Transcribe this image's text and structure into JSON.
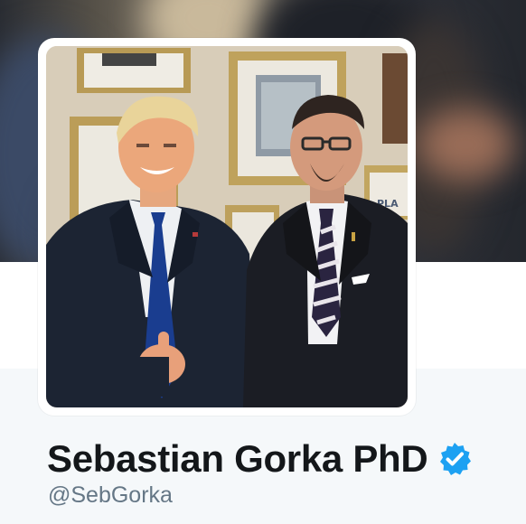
{
  "profile": {
    "display_name": "Sebastian Gorka PhD",
    "handle": "@SebGorka",
    "verified": true
  },
  "photo": {
    "sign_text": "PLA"
  },
  "icons": {
    "verified": "verified-badge-icon"
  },
  "colors": {
    "name": "#14171a",
    "handle": "#657786",
    "verified": "#1da1f2",
    "page_background": "#f5f8fa"
  }
}
